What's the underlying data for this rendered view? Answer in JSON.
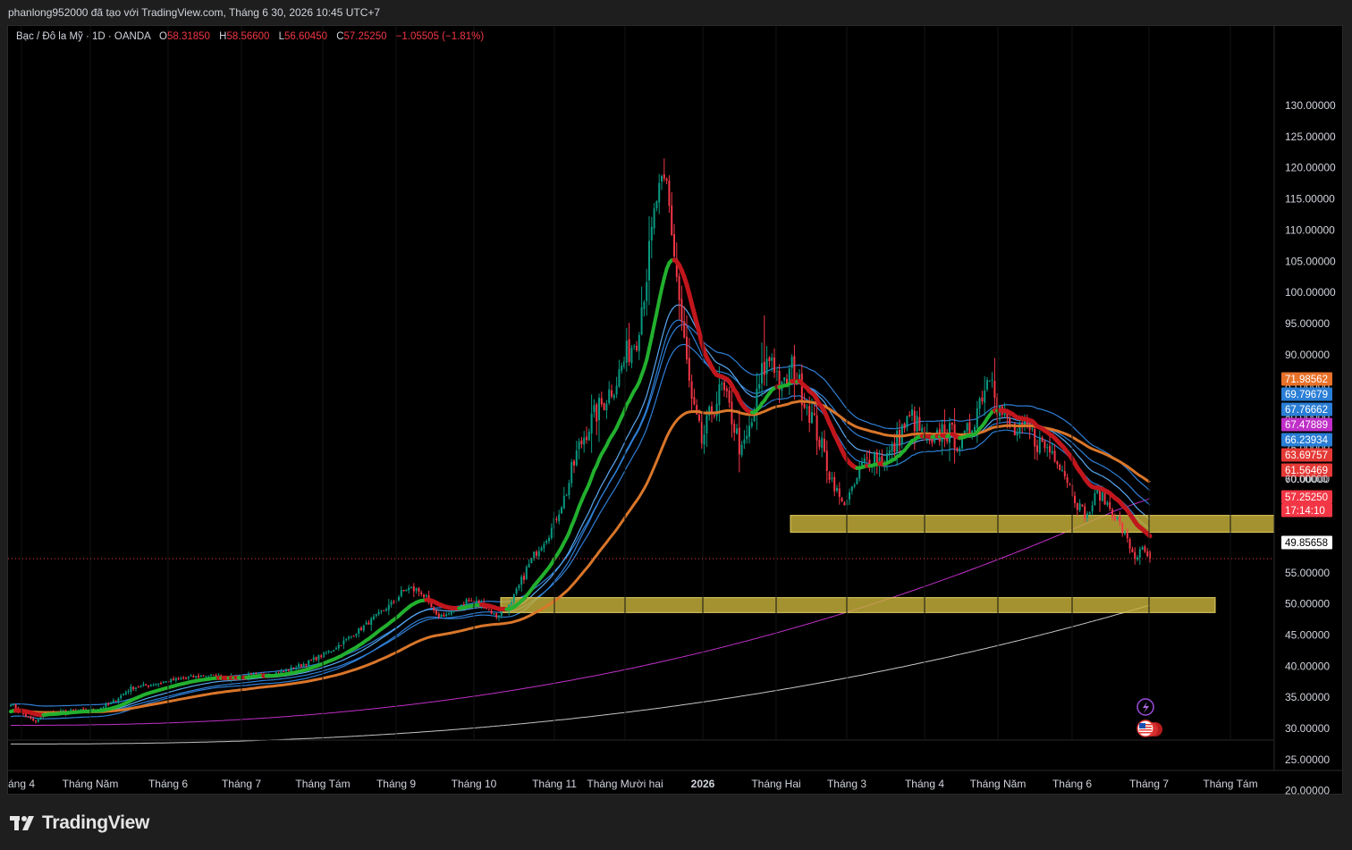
{
  "header": {
    "credit": "phanlong952000 đã tạo với TradingView.com, Tháng 6 30, 2026 10:45 UTC+7"
  },
  "legend": {
    "symbol": "Bạc / Đô la Mỹ · 1D · OANDA",
    "open_label": "O",
    "open": "58.31850",
    "high_label": "H",
    "high": "58.56600",
    "low_label": "L",
    "low": "56.60450",
    "close_label": "C",
    "close": "57.25250",
    "change": "−1.05505 (−1.81%)"
  },
  "brand": {
    "name": "TradingView"
  },
  "colors": {
    "up": "#089981",
    "down": "#f23645",
    "ema_green": "#22b02e",
    "ema_red": "#c0161c",
    "blue": "#2f7fd6",
    "orange": "#d9762a",
    "magenta": "#c030c8",
    "zone": "#c8b23c"
  },
  "chart_data": {
    "type": "candlestick",
    "yaxis": {
      "ticks": [
        "130.00000",
        "125.00000",
        "120.00000",
        "115.00000",
        "110.00000",
        "105.00000",
        "100.00000",
        "95.00000",
        "90.00000",
        "85.00000",
        "80.00000",
        "75.00000",
        "70.00000",
        "65.00000",
        "60.00000",
        "55.00000",
        "50.00000",
        "45.00000",
        "40.00000",
        "35.00000",
        "30.00000",
        "25.00000",
        "20.00000"
      ],
      "range": [
        18,
        131
      ]
    },
    "xaxis": {
      "labels": [
        "áng 4",
        "Tháng Năm",
        "Tháng 6",
        "Tháng 7",
        "Tháng Tám",
        "Tháng 9",
        "Tháng 10",
        "Tháng 11",
        "Tháng Mười hai",
        "2026",
        "Tháng Hai",
        "Tháng 3",
        "Tháng 4",
        "Tháng Năm",
        "Tháng 6",
        "Tháng 7",
        "Tháng Tám"
      ]
    },
    "price_tags": [
      {
        "value": "71.98562",
        "color": "#e8722a"
      },
      {
        "value": "69.79679",
        "color": "#2a7ed6"
      },
      {
        "value": "67.76662",
        "color": "#2a7ed6"
      },
      {
        "value": "67.47889",
        "color": "#c030c8"
      },
      {
        "value": "66.23934",
        "color": "#2a7ed6"
      },
      {
        "value": "63.69757",
        "color": "#e53935"
      },
      {
        "value": "61.56469",
        "color": "#e53935"
      },
      {
        "value": "60.00000",
        "color": "none"
      },
      {
        "value": "57.25250",
        "color": "#f23645"
      },
      {
        "value": "17:14:10",
        "color": "#f23645"
      },
      {
        "value": "49.85658",
        "color": "#ffffff"
      }
    ],
    "zones": [
      {
        "low": 61.5,
        "high": 64.2
      },
      {
        "low": 48.6,
        "high": 51.0
      }
    ],
    "anchors": [
      [
        -4,
        33.5
      ],
      [
        0,
        34
      ],
      [
        6,
        32
      ],
      [
        10,
        31
      ],
      [
        14,
        32.5
      ],
      [
        24,
        32.8
      ],
      [
        34,
        33
      ],
      [
        40,
        34
      ],
      [
        48,
        36.5
      ],
      [
        58,
        37.2
      ],
      [
        68,
        38
      ],
      [
        78,
        38.5
      ],
      [
        88,
        38.2
      ],
      [
        100,
        38.6
      ],
      [
        108,
        39
      ],
      [
        118,
        40.5
      ],
      [
        128,
        42.5
      ],
      [
        136,
        44.8
      ],
      [
        146,
        48
      ],
      [
        152,
        50
      ],
      [
        158,
        52.5
      ],
      [
        164,
        52
      ],
      [
        170,
        48
      ],
      [
        176,
        48.5
      ],
      [
        182,
        50.5
      ],
      [
        188,
        50
      ],
      [
        194,
        48
      ],
      [
        200,
        50
      ],
      [
        206,
        55.5
      ],
      [
        210,
        58.5
      ],
      [
        216,
        62
      ],
      [
        222,
        68
      ],
      [
        226,
        74
      ],
      [
        230,
        78
      ],
      [
        236,
        82
      ],
      [
        242,
        86
      ],
      [
        246,
        90
      ],
      [
        250,
        93
      ],
      [
        254,
        103
      ],
      [
        258,
        115
      ],
      [
        262,
        117
      ],
      [
        264,
        110
      ],
      [
        268,
        95
      ],
      [
        272,
        82
      ],
      [
        276,
        76
      ],
      [
        280,
        81
      ],
      [
        284,
        84.5
      ],
      [
        288,
        80
      ],
      [
        292,
        74
      ],
      [
        296,
        79
      ],
      [
        300,
        87
      ],
      [
        304,
        90
      ],
      [
        308,
        84
      ],
      [
        312,
        88
      ],
      [
        316,
        84
      ],
      [
        320,
        80
      ],
      [
        324,
        75
      ],
      [
        328,
        70
      ],
      [
        332,
        66
      ],
      [
        336,
        68
      ],
      [
        340,
        72
      ],
      [
        344,
        74
      ],
      [
        348,
        73
      ],
      [
        352,
        74.5
      ],
      [
        356,
        78
      ],
      [
        360,
        80
      ],
      [
        364,
        77
      ],
      [
        368,
        75
      ],
      [
        372,
        78
      ],
      [
        376,
        77
      ],
      [
        380,
        75.5
      ],
      [
        384,
        79
      ],
      [
        388,
        84
      ],
      [
        392,
        88
      ],
      [
        394,
        82
      ],
      [
        398,
        79
      ],
      [
        402,
        77
      ],
      [
        406,
        78
      ],
      [
        410,
        76
      ],
      [
        414,
        75
      ],
      [
        418,
        74
      ],
      [
        422,
        70
      ],
      [
        426,
        66
      ],
      [
        430,
        64
      ],
      [
        434,
        68
      ],
      [
        438,
        66
      ],
      [
        442,
        63.5
      ],
      [
        446,
        60
      ],
      [
        449,
        57.5
      ],
      [
        452,
        58.5
      ],
      [
        455,
        57.25
      ]
    ],
    "candle_count": 456,
    "moving_averages": [
      {
        "period": 20,
        "color": "#22b02e"
      },
      {
        "period": 34,
        "color": "#2f7fd6"
      },
      {
        "period": 50,
        "color": "#2f7fd6"
      },
      {
        "period": 89,
        "color": "#d9762a"
      },
      {
        "period": 200,
        "color": "#c030c8"
      },
      {
        "period": 450,
        "color": "#dcdcdc"
      }
    ]
  }
}
